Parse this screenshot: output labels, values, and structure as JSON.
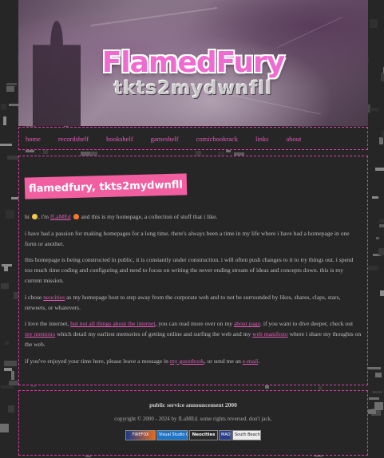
{
  "header": {
    "logo_title": "FlamedFury",
    "logo_subtitle": "tkts2mydwnfll"
  },
  "nav": {
    "items": [
      {
        "label": "home"
      },
      {
        "label": "recordshelf"
      },
      {
        "label": "bookshelf"
      },
      {
        "label": "gameshelf"
      },
      {
        "label": "comicbookrack"
      },
      {
        "label": "links"
      },
      {
        "label": "about"
      }
    ]
  },
  "main": {
    "title": "flamedfury, tkts2mydwnfll",
    "intro": {
      "hi": "hi",
      "im": ", i'm",
      "name_link": "fLaMEd",
      "rest": "and this is my homepage, a collection of stuff that i like."
    },
    "para2": "i have had a passion for making homepages for a long time. there's always been a time in my life where i have had a homepage in one form or another.",
    "para3": "this homepage is being constructed in public, it is constantly under construction. i will often push changes to it to try things out. i spend too much time coding and configuring and need to focus on writing the never ending stream of ideas and concepts down. this is my current mission.",
    "para4": {
      "a": "i chose",
      "link": "neocities",
      "b": "as my homepage host to step away from the corporate web and to not be surrounded by likes, shares, claps, stars, retweets, or whatevers."
    },
    "para5": {
      "a": "i love the internet,",
      "link1": "but not all things about the internet",
      "b": ", you can read more over on my",
      "link2": "about page",
      "c": ". if you want to dive deeper, check out",
      "link3": "my memoirs",
      "d": "which detail my earliest memories of getting online and surfing the web and my",
      "link4": "web manifesto",
      "e": "where i share my thoughts on the web."
    },
    "para6": {
      "a": "if you've enjoyed your time here, please leave a message in",
      "link1": "my guestbook",
      "b": ", or send me an",
      "link2": "e-mail",
      "c": "."
    }
  },
  "footer": {
    "psa": "public service announcement 2000",
    "copyright": "copyright © 2000 - 2024 by fLaMEd. some rights reversed. don't jack.",
    "badges": [
      {
        "label": "FIREFOX"
      },
      {
        "label": "Visual Studio Code"
      },
      {
        "label": "Neocities"
      },
      {
        "label": "MADE ON A"
      },
      {
        "label": "South Beach"
      }
    ]
  },
  "colors": {
    "accent": "#e45aba",
    "title_badge": "#f25fa0",
    "border": "#e03aa8",
    "background": "#262626"
  }
}
